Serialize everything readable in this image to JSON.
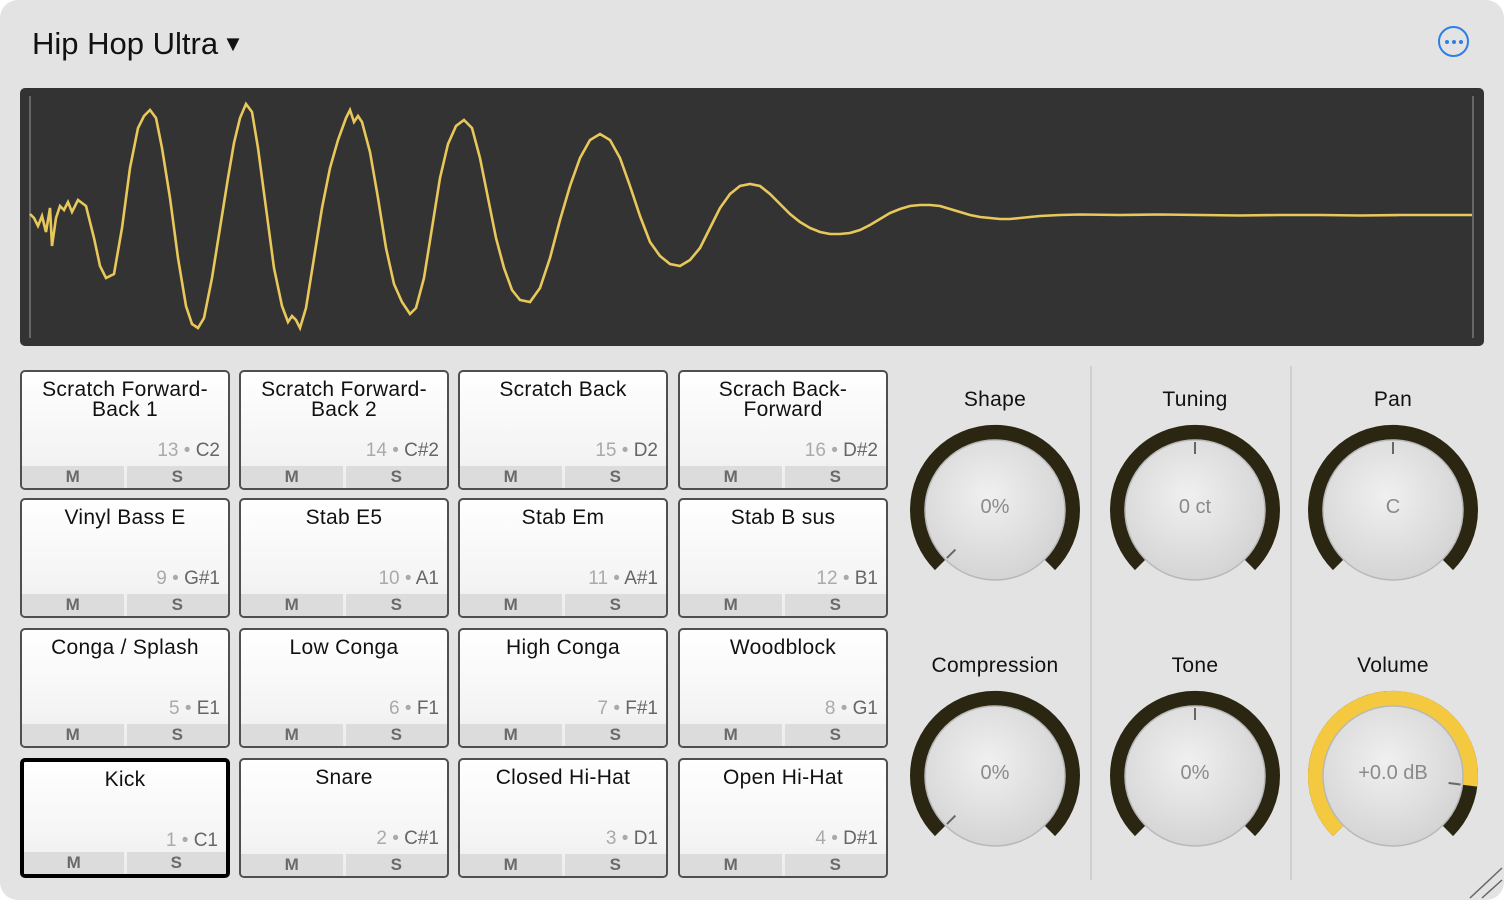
{
  "header": {
    "preset_name": "Hip Hop Ultra",
    "caret": "▼",
    "more_icon": "ellipsis-circle-icon"
  },
  "colors": {
    "waveform": "#e8c85a",
    "accent": "#2c7fe6",
    "knob_track": "#2b2612",
    "volume_fill": "#f4c940"
  },
  "pads": [
    {
      "name": "Scratch Forward-Back 1",
      "num": "13",
      "note": "C2",
      "mute": "M",
      "solo": "S"
    },
    {
      "name": "Scratch Forward-Back 2",
      "num": "14",
      "note": "C#2",
      "mute": "M",
      "solo": "S"
    },
    {
      "name": "Scratch Back",
      "num": "15",
      "note": "D2",
      "mute": "M",
      "solo": "S"
    },
    {
      "name": "Scrach Back-Forward",
      "num": "16",
      "note": "D#2",
      "mute": "M",
      "solo": "S"
    },
    {
      "name": "Vinyl Bass E",
      "num": "9",
      "note": "G#1",
      "mute": "M",
      "solo": "S"
    },
    {
      "name": "Stab E5",
      "num": "10",
      "note": "A1",
      "mute": "M",
      "solo": "S"
    },
    {
      "name": "Stab Em",
      "num": "11",
      "note": "A#1",
      "mute": "M",
      "solo": "S"
    },
    {
      "name": "Stab B sus",
      "num": "12",
      "note": "B1",
      "mute": "M",
      "solo": "S"
    },
    {
      "name": "Conga / Splash",
      "num": "5",
      "note": "E1",
      "mute": "M",
      "solo": "S"
    },
    {
      "name": "Low Conga",
      "num": "6",
      "note": "F1",
      "mute": "M",
      "solo": "S"
    },
    {
      "name": "High Conga",
      "num": "7",
      "note": "F#1",
      "mute": "M",
      "solo": "S"
    },
    {
      "name": "Woodblock",
      "num": "8",
      "note": "G1",
      "mute": "M",
      "solo": "S"
    },
    {
      "name": "Kick",
      "num": "1",
      "note": "C1",
      "mute": "M",
      "solo": "S",
      "selected": true
    },
    {
      "name": "Snare",
      "num": "2",
      "note": "C#1",
      "mute": "M",
      "solo": "S"
    },
    {
      "name": "Closed Hi-Hat",
      "num": "3",
      "note": "D1",
      "mute": "M",
      "solo": "S"
    },
    {
      "name": "Open Hi-Hat",
      "num": "4",
      "note": "D#1",
      "mute": "M",
      "solo": "S"
    }
  ],
  "knobs": [
    {
      "label": "Shape",
      "value": "0%",
      "level": 0.0,
      "bipolar": false
    },
    {
      "label": "Tuning",
      "value": "0 ct",
      "level": 0.5,
      "bipolar": true
    },
    {
      "label": "Pan",
      "value": "C",
      "level": 0.5,
      "bipolar": true
    },
    {
      "label": "Compression",
      "value": "0%",
      "level": 0.0,
      "bipolar": false
    },
    {
      "label": "Tone",
      "value": "0%",
      "level": 0.5,
      "bipolar": true
    },
    {
      "label": "Volume",
      "value": "+0.0 dB",
      "level": 0.86,
      "bipolar": false,
      "filled": true
    }
  ],
  "resize_icon": "resize-grip-icon"
}
